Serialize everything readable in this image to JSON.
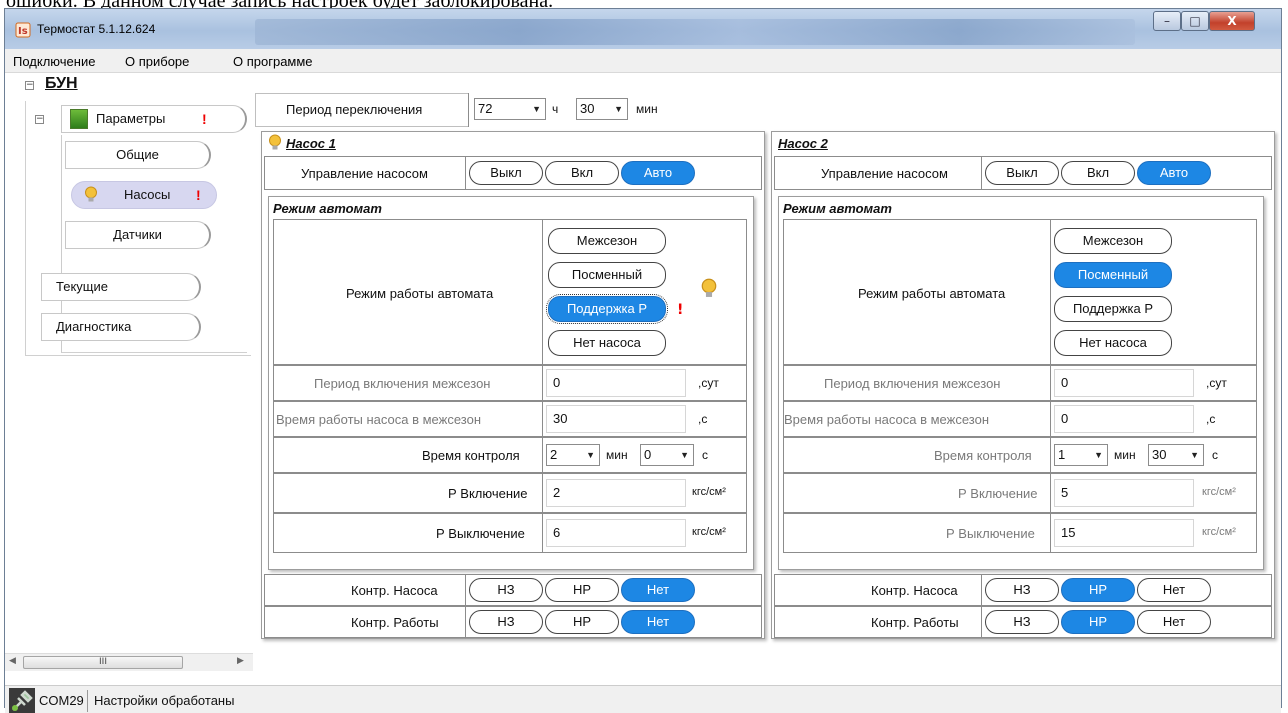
{
  "doc_strip_text": "ошибки. В данном случае запись настроек будет заблокирована.",
  "window": {
    "title": "Термостат 5.1.12.624",
    "minimize_glyph": "–",
    "maximize_glyph": "□",
    "close_glyph": "X"
  },
  "menu": [
    "Подключение",
    "О приборе",
    "О программе"
  ],
  "tree": {
    "root": "БУН",
    "params": "Параметры",
    "params_excl": "!",
    "general": "Общие",
    "pumps": "Насосы",
    "pumps_excl": "!",
    "sensors": "Датчики",
    "current": "Текущие",
    "diagnostics": "Диагностика",
    "scroll_thumb": "III"
  },
  "switch_period": {
    "label": "Период переключения",
    "hours": "72",
    "hours_unit": "ч",
    "minutes": "30",
    "minutes_unit": "мин"
  },
  "pump1": {
    "title": "Насос 1",
    "control_label": "Управление насосом",
    "control_options": [
      "Выкл",
      "Вкл",
      "Авто"
    ],
    "control_selected": "Авто",
    "auto_title": "Режим автомат",
    "mode_label": "Режим работы автомата",
    "modes": [
      "Межсезон",
      "Посменный",
      "Поддержка Р",
      "Нет насоса"
    ],
    "mode_selected": "Поддержка Р",
    "mode_excl": "!",
    "period_label": "Период включения межсезон",
    "period_value": "0",
    "period_unit": ",сут",
    "runtime_label": "Время работы насоса в межсезон",
    "runtime_value": "30",
    "runtime_unit": ",с",
    "ctrl_time_label": "Время контроля",
    "ctrl_time_min": "2",
    "ctrl_time_min_unit": "мин",
    "ctrl_time_sec": "0",
    "ctrl_time_sec_unit": "с",
    "p_on_label": "Р Включение",
    "p_on_value": "2",
    "p_on_unit": "кгс/см²",
    "p_off_label": "Р Выключение",
    "p_off_value": "6",
    "p_off_unit": "кгс/см²",
    "contr_pump_label": "Контр. Насоса",
    "contr_pump_options": [
      "НЗ",
      "НР",
      "Нет"
    ],
    "contr_pump_selected": "Нет",
    "contr_work_label": "Контр. Работы",
    "contr_work_options": [
      "НЗ",
      "НР",
      "Нет"
    ],
    "contr_work_selected": "Нет"
  },
  "pump2": {
    "title": "Насос 2",
    "control_label": "Управление насосом",
    "control_options": [
      "Выкл",
      "Вкл",
      "Авто"
    ],
    "control_selected": "Авто",
    "auto_title": "Режим автомат",
    "mode_label": "Режим работы автомата",
    "modes": [
      "Межсезон",
      "Посменный",
      "Поддержка Р",
      "Нет насоса"
    ],
    "mode_selected": "Посменный",
    "period_label": "Период включения межсезон",
    "period_value": "0",
    "period_unit": ",сут",
    "runtime_label": "Время работы насоса в межсезон",
    "runtime_value": "0",
    "runtime_unit": ",с",
    "ctrl_time_label": "Время контроля",
    "ctrl_time_min": "1",
    "ctrl_time_min_unit": "мин",
    "ctrl_time_sec": "30",
    "ctrl_time_sec_unit": "с",
    "p_on_label": "Р Включение",
    "p_on_value": "5",
    "p_on_unit": "кгс/см²",
    "p_off_label": "Р Выключение",
    "p_off_value": "15",
    "p_off_unit": "кгс/см²",
    "contr_pump_label": "Контр. Насоса",
    "contr_pump_options": [
      "НЗ",
      "НР",
      "Нет"
    ],
    "contr_pump_selected": "НР",
    "contr_work_label": "Контр. Работы",
    "contr_work_options": [
      "НЗ",
      "НР",
      "Нет"
    ],
    "contr_work_selected": "НР"
  },
  "status": {
    "port": "COM29",
    "message": "Настройки обработаны"
  },
  "icons": {
    "bulb_color": "#f3c13a",
    "accent": "#1d87e4",
    "error_color": "#e00000"
  }
}
